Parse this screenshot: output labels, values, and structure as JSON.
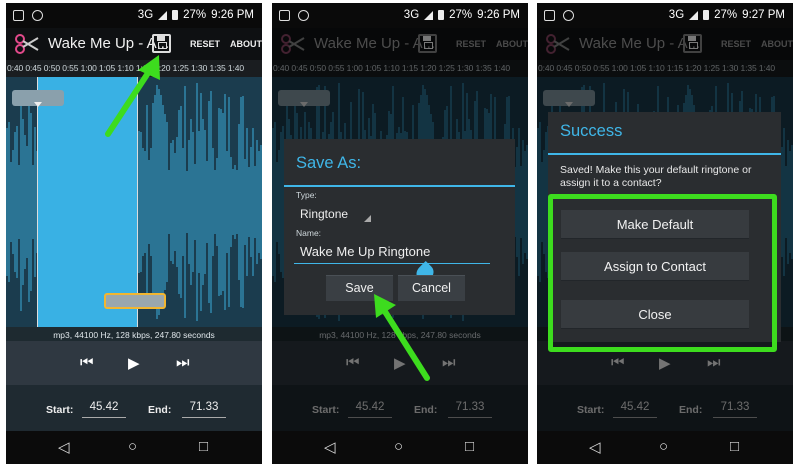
{
  "status": {
    "network": "3G",
    "battery": "27%",
    "time_p1": "9:26 PM",
    "time_p2": "9:26 PM",
    "time_p3": "9:27 PM"
  },
  "app": {
    "title": "Wake Me Up - A...",
    "reset_label": "RESET",
    "about_label": "ABOUT",
    "ruler_ticks": "0:40 0:45 0:50 0:55 1:00 1:05 1:10 1:15 1:20 1:25 1:30 1:35 1:40",
    "file_info": "mp3, 44100 Hz, 128 kbps, 247.80 seconds",
    "start_label": "Start:",
    "start_value": "45.42",
    "end_label": "End:",
    "end_value": "71.33"
  },
  "save_dialog": {
    "title": "Save As:",
    "type_label": "Type:",
    "type_value": "Ringtone",
    "name_label": "Name:",
    "name_value": "Wake Me Up Ringtone",
    "save_label": "Save",
    "cancel_label": "Cancel"
  },
  "success_dialog": {
    "title": "Success",
    "message": "Saved! Make this your default ringtone or assign it to a contact?",
    "make_default_label": "Make Default",
    "assign_label": "Assign to Contact",
    "close_label": "Close"
  },
  "icons": [
    "image-icon",
    "sync-icon",
    "signal-icon",
    "battery-icon",
    "scissors-logo-icon",
    "save-icon",
    "skip-previous-icon",
    "play-icon",
    "skip-next-icon",
    "back-icon",
    "home-icon",
    "recents-icon"
  ],
  "colors": {
    "accent": "#3fb6e8",
    "selection": "#39b1e4",
    "highlight": "#3ddc1e",
    "arrow": "#3ddc1e"
  }
}
